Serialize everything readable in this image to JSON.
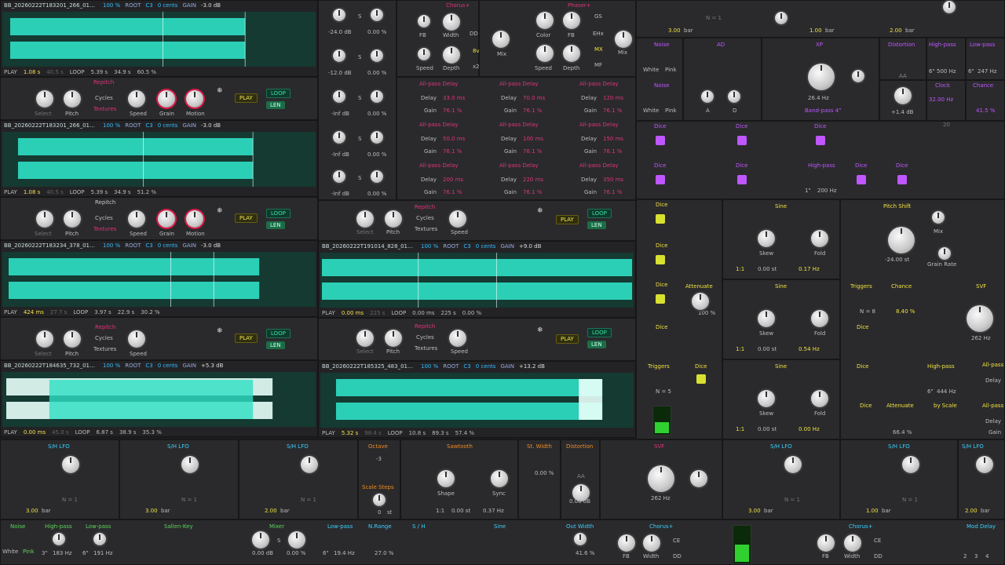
{
  "samplers": [
    {
      "file": "BB_20260222T183201_266_0100_110BPM.wav",
      "pct": "100 %",
      "root": "ROOT",
      "note": "C3",
      "cents": "0 cents",
      "gain_label": "GAIN",
      "gain": "-3.0 dB",
      "f": [
        "PLAY",
        "1.08 s",
        "40.5 s",
        "LOOP",
        "5.39 s",
        "34.9 s",
        "60.5 %"
      ]
    },
    {
      "file": "BB_20260222T183201_266_0100_110BPM.wav",
      "pct": "100 %",
      "root": "ROOT",
      "note": "C3",
      "cents": "0 cents",
      "gain_label": "GAIN",
      "gain": "-3.0 dB",
      "f": [
        "PLAY",
        "1.08 s",
        "40.5 s",
        "LOOP",
        "5.39 s",
        "34.9 s",
        "51.2 %"
      ]
    },
    {
      "file": "BB_20260222T183234_378_0100_110BPM.wav",
      "pct": "100 %",
      "root": "ROOT",
      "note": "C3",
      "cents": "0 cents",
      "gain_label": "GAIN",
      "gain": "-3.0 dB",
      "f": [
        "PLAY",
        "424 ms",
        "27.7 s",
        "LOOP",
        "3.97 s",
        "22.9 s",
        "30.2 %"
      ]
    },
    {
      "file": "BB_20260222T184635_732_0100_110BPM.wav",
      "pct": "100 %",
      "root": "ROOT",
      "note": "C3",
      "cents": "0 cents",
      "gain_label": "GAIN",
      "gain": "+5.3 dB",
      "f": [
        "PLAY",
        "0.00 ms",
        "45.0 s",
        "LOOP",
        "6.87 s",
        "38.9 s",
        "35.3 %"
      ]
    },
    {
      "file": "BB_20260222T191014_828_0100_110BPM.wav",
      "pct": "100 %",
      "root": "ROOT",
      "note": "C3",
      "cents": "0 cents",
      "gain_label": "GAIN",
      "gain": "+9.0 dB",
      "f": [
        "PLAY",
        "0.00 ms",
        "225 s",
        "LOOP",
        "0.00 ms",
        "225 s",
        "0.00 %"
      ]
    },
    {
      "file": "BB_20260222T185325_483_0100_110BPM.wav",
      "pct": "100 %",
      "root": "ROOT",
      "note": "C3",
      "cents": "0 cents",
      "gain_label": "GAIN",
      "gain": "+13.2 dB",
      "f": [
        "PLAY",
        "5.32 s",
        "98.4 s",
        "LOOP",
        "10.8 s",
        "89.3 s",
        "57.4 %"
      ]
    }
  ],
  "repitch": {
    "title": "Repitch",
    "cycles": "Cycles",
    "textures": "Textures",
    "select": "Select",
    "pitch": "Pitch",
    "speed": "Speed",
    "grain": "Grain",
    "motion": "Motion",
    "play": "PLAY",
    "loop": "LOOP",
    "len": "LEN"
  },
  "mixer_strip": [
    {
      "db": "-24.0 dB",
      "s": "S",
      "pct": "0.00 %"
    },
    {
      "db": "-12.0 dB",
      "s": "S",
      "pct": "0.00 %"
    },
    {
      "db": "-Inf dB",
      "s": "S",
      "pct": "0.00 %"
    },
    {
      "db": "-Inf dB",
      "s": "S",
      "pct": "0.00 %"
    },
    {
      "db": "-Inf dB",
      "s": "S",
      "pct": "0.00 %"
    }
  ],
  "chorus": {
    "title": "Chorus+",
    "fb": "FB",
    "width": "Width",
    "speed": "Speed",
    "depth": "Depth",
    "dd": "DD",
    "v8": "8v",
    "x2": "x2",
    "mix": "Mix"
  },
  "phaser": {
    "title": "Phaser+",
    "color": "Color",
    "fb": "FB",
    "speed": "Speed",
    "depth": "Depth",
    "gs": "GS",
    "ehx": "EHx",
    "mx": "MX",
    "mf": "MF",
    "mix": "Mix"
  },
  "allpass": [
    {
      "title": "All-pass Delay",
      "delay": "33.0 ms",
      "gain": "76.1 %"
    },
    {
      "title": "All-pass Delay",
      "delay": "70.0 ms",
      "gain": "76.1 %"
    },
    {
      "title": "All-pass Delay",
      "delay": "120 ms",
      "gain": "76.1 %"
    },
    {
      "title": "All-pass Delay",
      "delay": "50.0 ms",
      "gain": "76.1 %"
    },
    {
      "title": "All-pass Delay",
      "delay": "100 ms",
      "gain": "76.1 %"
    },
    {
      "title": "All-pass Delay",
      "delay": "150 ms",
      "gain": "76.1 %"
    },
    {
      "title": "All-pass Delay",
      "delay": "200 ms",
      "gain": "76.1 %"
    },
    {
      "title": "All-pass Delay",
      "delay": "220 ms",
      "gain": "76.1 %"
    },
    {
      "title": "All-pass Delay",
      "delay": "350 ms",
      "gain": "76.1 %"
    }
  ],
  "ap_labels": {
    "delay": "Delay",
    "gain": "Gain"
  },
  "right_top": {
    "bar1": "3.00",
    "bar2": "1.00",
    "bar3": "2.00",
    "bar_unit": "bar",
    "n1": "N = 1",
    "noise": "Noise",
    "white": "White",
    "pink": "Pink",
    "ad": "AD",
    "a": "A",
    "d": "D",
    "xp": "XP",
    "xp_freq": "26.4 Hz",
    "band": "Band-pass 4\"",
    "distortion": "Distortion",
    "aa": "AA",
    "dist_db": "+1.4 dB",
    "highpass": "High-pass",
    "hp_freq": "500 Hz",
    "hp_freq2": "6\"",
    "lowpass": "Low-pass",
    "lp_freq": "247 Hz",
    "lp_freq2": "6\"",
    "clock": "Clock",
    "clock_val": "32.00 Hz",
    "chance": "Chance",
    "chance_val": "41.5 %",
    "dice": "Dice",
    "hp2": "High-pass",
    "hp2_val": "200 Hz",
    "hp2_slope": "1\"",
    "pitch_shift": "Pitch Shift",
    "ps_val": "-24.00 st",
    "mix": "Mix",
    "grain_rate": "Grain Rate",
    "scope_lbl": "20"
  },
  "sine_rows": [
    {
      "title": "Sine",
      "skew": "Skew",
      "fold": "Fold",
      "ratio": "1:1",
      "st": "0.00 st",
      "hz": "0.17 Hz"
    },
    {
      "title": "Sine",
      "skew": "Skew",
      "fold": "Fold",
      "ratio": "1:1",
      "st": "0.00 st",
      "hz": "0.54 Hz"
    },
    {
      "title": "Sine",
      "skew": "Skew",
      "fold": "Fold",
      "ratio": "1:1",
      "st": "0.00 st",
      "hz": "0.00 Hz"
    }
  ],
  "mid_right": {
    "attenuate": "Attenuate",
    "att_val": "100 %",
    "triggers": "Triggers",
    "n8": "N = 8",
    "n5": "N = 5",
    "chance": "Chance",
    "chance_val": "8.40 %",
    "svf": "SVF",
    "svf_val": "262 Hz",
    "hp": "High-pass",
    "hp_val": "444 Hz",
    "hp_slope": "6\"",
    "att2": "Attenuate",
    "att2_val": "66.4 %",
    "by_scale": "by Scale",
    "allpass": "All-pass",
    "delay": "Delay",
    "gain": "Gain",
    "dice": "Dice"
  },
  "sh_lfos": [
    {
      "title": "S/H LFO",
      "bar": "3.00",
      "n": "N = 1"
    },
    {
      "title": "S/H LFO",
      "bar": "3.00",
      "n": "N = 1"
    },
    {
      "title": "S/H LFO",
      "bar": "2.00",
      "n": "N = 1"
    },
    {
      "title": "S/H LFO",
      "bar": "3.00",
      "n": "N = 1"
    },
    {
      "title": "S/H LFO",
      "bar": "1.00",
      "n": "N = 1"
    },
    {
      "title": "S/H LFO",
      "bar": "2.00",
      "n": "N = 1"
    }
  ],
  "bottom_mid": {
    "octave": "Octave",
    "oct_val": "-3",
    "scale_steps": "Scale Steps",
    "ss_val": "0",
    "ss_unit": "st",
    "sawtooth": "Sawtooth",
    "shape": "Shape",
    "sync": "Sync",
    "ratio": "1:1",
    "st": "0.00 st",
    "hz": "0.37 Hz",
    "st_width": "St. Width",
    "stw_val": "0.00 %",
    "distortion": "Distortion",
    "aa": "AA",
    "dist_db": "0.00 dB",
    "svf": "SVF",
    "svf_val": "262 Hz",
    "bar_unit": "bar"
  },
  "bottom_row": {
    "noise": "Noise",
    "white": "White",
    "pink": "Pink",
    "highpass": "High-pass",
    "hp_val": "183 Hz",
    "hp_sl": "3\"",
    "lowpass": "Low-pass",
    "lp_val": "191 Hz",
    "lp_sl": "6\"",
    "sallen": "Sallen-Key",
    "mixer": "Mixer",
    "mix_db": "0.00 dB",
    "mix_s": "S",
    "mix_pct": "0.00 %",
    "lowpass2": "Low-pass",
    "lp2_val": "19.4 Hz",
    "lp2_sl": "6\"",
    "nrange": "N.Range",
    "nr_val": "27.0 %",
    "sh": "S / H",
    "sine": "Sine",
    "out_width": "Out Width",
    "ow_val": "41.6 %",
    "chorus": "Chorus+",
    "fb": "FB",
    "width": "Width",
    "ce": "CE",
    "dd": "DD",
    "chorus2": "Chorus+",
    "mod_delay": "Mod Delay",
    "nums": [
      "2",
      "3",
      "4"
    ]
  }
}
